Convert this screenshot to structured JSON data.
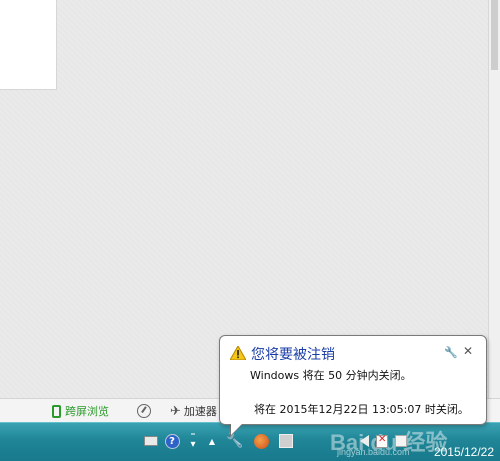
{
  "statusbar": {
    "split_view_label": "跨屏浏览",
    "accelerator_label": "加速器"
  },
  "notification": {
    "title": "您将要被注销",
    "line1": "Windows 将在 50 分钟内关闭。",
    "line2": "将在 2015年12月22日 13:05:07 时关闭。",
    "close_glyph": "✕",
    "settings_glyph": "🔧"
  },
  "taskbar": {
    "date": "2015/12/22",
    "watermark": "Bai du 经验",
    "watermark_url": "jingyan.baidu.com"
  },
  "colors": {
    "taskbar": "#1f8597",
    "title_blue": "#1a3ea8",
    "split_green": "#2a9a2a"
  }
}
